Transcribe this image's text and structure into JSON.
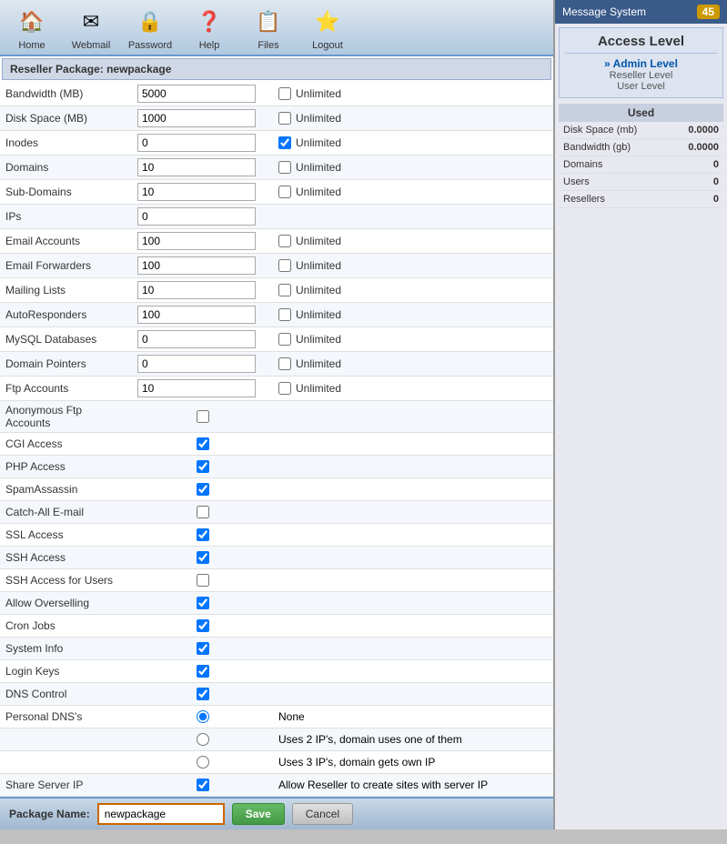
{
  "nav": {
    "items": [
      {
        "label": "Home",
        "icon": "🏠"
      },
      {
        "label": "Webmail",
        "icon": "✉"
      },
      {
        "label": "Password",
        "icon": "🔒"
      },
      {
        "label": "Help",
        "icon": "❓"
      },
      {
        "label": "Files",
        "icon": "📋"
      },
      {
        "label": "Logout",
        "icon": "⭐"
      }
    ]
  },
  "package": {
    "header": "Reseller Package: newpackage",
    "name": "newpackage"
  },
  "fields": [
    {
      "label": "Bandwidth (MB)",
      "value": "5000",
      "has_unlimited": true,
      "unlimited_checked": false,
      "type": "text"
    },
    {
      "label": "Disk Space (MB)",
      "value": "1000",
      "has_unlimited": true,
      "unlimited_checked": false,
      "type": "text"
    },
    {
      "label": "Inodes",
      "value": "0",
      "has_unlimited": true,
      "unlimited_checked": true,
      "type": "text"
    },
    {
      "label": "Domains",
      "value": "10",
      "has_unlimited": true,
      "unlimited_checked": false,
      "type": "text"
    },
    {
      "label": "Sub-Domains",
      "value": "10",
      "has_unlimited": true,
      "unlimited_checked": false,
      "type": "text"
    },
    {
      "label": "IPs",
      "value": "0",
      "has_unlimited": false,
      "type": "text"
    },
    {
      "label": "Email Accounts",
      "value": "100",
      "has_unlimited": true,
      "unlimited_checked": false,
      "type": "text"
    },
    {
      "label": "Email Forwarders",
      "value": "100",
      "has_unlimited": true,
      "unlimited_checked": false,
      "type": "text"
    },
    {
      "label": "Mailing Lists",
      "value": "10",
      "has_unlimited": true,
      "unlimited_checked": false,
      "type": "text"
    },
    {
      "label": "AutoResponders",
      "value": "100",
      "has_unlimited": true,
      "unlimited_checked": false,
      "type": "text"
    },
    {
      "label": "MySQL Databases",
      "value": "0",
      "has_unlimited": true,
      "unlimited_checked": false,
      "type": "text"
    },
    {
      "label": "Domain Pointers",
      "value": "0",
      "has_unlimited": true,
      "unlimited_checked": false,
      "type": "text"
    },
    {
      "label": "Ftp Accounts",
      "value": "10",
      "has_unlimited": true,
      "unlimited_checked": false,
      "type": "text"
    },
    {
      "label": "Anonymous Ftp Accounts",
      "value": "",
      "has_unlimited": false,
      "type": "checkbox",
      "checked": false
    },
    {
      "label": "CGI Access",
      "value": "",
      "has_unlimited": false,
      "type": "checkbox",
      "checked": true
    },
    {
      "label": "PHP Access",
      "value": "",
      "has_unlimited": false,
      "type": "checkbox",
      "checked": true
    },
    {
      "label": "SpamAssassin",
      "value": "",
      "has_unlimited": false,
      "type": "checkbox",
      "checked": true
    },
    {
      "label": "Catch-All E-mail",
      "value": "",
      "has_unlimited": false,
      "type": "checkbox",
      "checked": false
    },
    {
      "label": "SSL Access",
      "value": "",
      "has_unlimited": false,
      "type": "checkbox",
      "checked": true
    },
    {
      "label": "SSH Access",
      "value": "",
      "has_unlimited": false,
      "type": "checkbox",
      "checked": true
    },
    {
      "label": "SSH Access for Users",
      "value": "",
      "has_unlimited": false,
      "type": "checkbox",
      "checked": false
    },
    {
      "label": "Allow Overselling",
      "value": "",
      "has_unlimited": false,
      "type": "checkbox",
      "checked": true
    },
    {
      "label": "Cron Jobs",
      "value": "",
      "has_unlimited": false,
      "type": "checkbox",
      "checked": true
    },
    {
      "label": "System Info",
      "value": "",
      "has_unlimited": false,
      "type": "checkbox",
      "checked": true
    },
    {
      "label": "Login Keys",
      "value": "",
      "has_unlimited": false,
      "type": "checkbox",
      "checked": true
    },
    {
      "label": "DNS Control",
      "value": "",
      "has_unlimited": false,
      "type": "checkbox",
      "checked": true
    },
    {
      "label": "Personal DNS's",
      "value": "",
      "has_unlimited": false,
      "type": "radio_group",
      "options": [
        {
          "label": "None",
          "checked": true
        },
        {
          "label": "Uses 2 IP's, domain uses one of them",
          "checked": false
        },
        {
          "label": "Uses 3 IP's, domain gets own IP",
          "checked": false
        }
      ]
    },
    {
      "label": "Share Server IP",
      "value": "",
      "has_unlimited": false,
      "type": "checkbox_with_text",
      "checked": true,
      "extra_text": "Allow Reseller to create sites with server IP"
    }
  ],
  "right_panel": {
    "message_system": "Message System",
    "badge": "45",
    "access_level_title": "Access Level",
    "admin_level": "» Admin Level",
    "reseller_level": "Reseller Level",
    "user_level": "User Level",
    "used_title": "Used",
    "stats": [
      {
        "label": "Disk Space (mb)",
        "value": "0.0000"
      },
      {
        "label": "Bandwidth (gb)",
        "value": "0.0000"
      },
      {
        "label": "Domains",
        "value": "0"
      },
      {
        "label": "Users",
        "value": "0"
      },
      {
        "label": "Resellers",
        "value": "0"
      }
    ]
  },
  "footer": {
    "package_name_label": "Package Name:",
    "package_name_value": "newpackage",
    "save_label": "Save",
    "cancel_label": "Cancel"
  }
}
